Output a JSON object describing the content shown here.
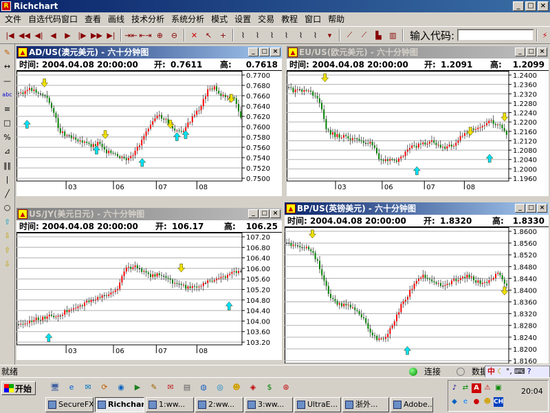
{
  "app": {
    "title": "Richchart",
    "icon": "rc"
  },
  "menu": [
    "文件",
    "自选代码窗口",
    "查看",
    "画线",
    "技术分析",
    "系统分析",
    "模式",
    "设置",
    "交易",
    "教程",
    "窗口",
    "帮助"
  ],
  "toolbar": {
    "icons": [
      "start-icon",
      "rewind-icon",
      "step-back-icon",
      "play-back-icon",
      "play-icon",
      "step-forward-icon",
      "fast-forward-icon",
      "end-icon",
      "compress-icon",
      "expand-icon",
      "zoom-in-icon",
      "zoom-out-icon",
      "delete-icon",
      "pointer-icon",
      "crosshair-icon",
      "line1-icon",
      "line2-icon",
      "line3-icon",
      "line4-icon",
      "line5-icon",
      "line6-icon",
      "dropdown-icon",
      "draw1-icon",
      "draw2-icon",
      "draw3-icon",
      "draw4-icon"
    ],
    "code_label": "输入代码:",
    "code_value": "",
    "lightning": "lightning-icon"
  },
  "left_tools": [
    "pencil-icon",
    "hline-icon",
    "hline2-icon",
    "abc-icon",
    "lines-icon",
    "rect-icon",
    "fib-icon",
    "gann-icon",
    "vlines-icon",
    "vline-icon",
    "arc-icon",
    "ellipse-icon",
    "arrow-up-cyan-icon",
    "arrow-down-yellow-icon",
    "arrow-up-yellow-icon",
    "arrow-down-yellow2-icon"
  ],
  "charts": [
    {
      "id": "ad",
      "title": "AD/US(澳元美元) - 六十分钟图",
      "time_label": "时间:",
      "time": "2004.04.08 20:00:00",
      "open_label": "开:",
      "open": "0.7611",
      "high_label": "高:",
      "high": "0.7618",
      "active": true,
      "y_ticks": [
        "0.7700",
        "0.7680",
        "0.7660",
        "0.7640",
        "0.7620",
        "0.7600",
        "0.7580",
        "0.7560",
        "0.7540",
        "0.7520",
        "0.7500"
      ],
      "x_ticks": [
        "03",
        "06",
        "07",
        "08"
      ]
    },
    {
      "id": "eu",
      "title": "EU/US(欧元美元) - 六十分钟图",
      "time_label": "时间:",
      "time": "2004.04.08 20:00:00",
      "open_label": "开:",
      "open": "1.2091",
      "high_label": "高:",
      "high": "1.2099",
      "active": false,
      "y_ticks": [
        "1.2400",
        "1.2360",
        "1.2320",
        "1.2280",
        "1.2240",
        "1.2200",
        "1.2160",
        "1.2120",
        "1.2080",
        "1.2040",
        "1.2000",
        "1.1960"
      ],
      "x_ticks": [
        "03",
        "06",
        "07",
        "08"
      ]
    },
    {
      "id": "jy",
      "title": "US/JY(美元日元) - 六十分钟图",
      "time_label": "时间:",
      "time": "2004.04.08 20:00:00",
      "open_label": "开:",
      "open": "106.17",
      "high_label": "高:",
      "high": "106.25",
      "active": false,
      "y_ticks": [
        "107.20",
        "106.80",
        "106.40",
        "106.00",
        "105.60",
        "105.20",
        "104.80",
        "104.40",
        "104.00",
        "103.60",
        "103.20"
      ],
      "x_ticks": [
        "03",
        "06",
        "07",
        "08"
      ]
    },
    {
      "id": "bp",
      "title": "BP/US(英镑美元) - 六十分钟图",
      "time_label": "时间:",
      "time": "2004.04.08 20:00:00",
      "open_label": "开:",
      "open": "1.8320",
      "high_label": "高:",
      "high": "1.8330",
      "active": true,
      "y_ticks": [
        "1.8600",
        "1.8560",
        "1.8520",
        "1.8480",
        "1.8440",
        "1.8400",
        "1.8360",
        "1.8320",
        "1.8280",
        "1.8240",
        "1.8200",
        "1.8160"
      ],
      "x_ticks": []
    }
  ],
  "status": {
    "text": "就绪",
    "connect": "连接",
    "data": "数据"
  },
  "taskbar": {
    "start": "开始",
    "tasks": [
      "SecureFX",
      "Richchart",
      "1:ww...",
      "2:ww...",
      "3:ww...",
      "UltraE...",
      "浙外...",
      "Adobe..."
    ],
    "active_task": "Richchart",
    "clock": "20:04",
    "ime": "中"
  },
  "colors": {
    "up": "#ff0000",
    "down": "#008000",
    "cyan_arrow": "#00e0ff",
    "yellow_arrow": "#f0e000",
    "titlebar": "#0a246a"
  }
}
